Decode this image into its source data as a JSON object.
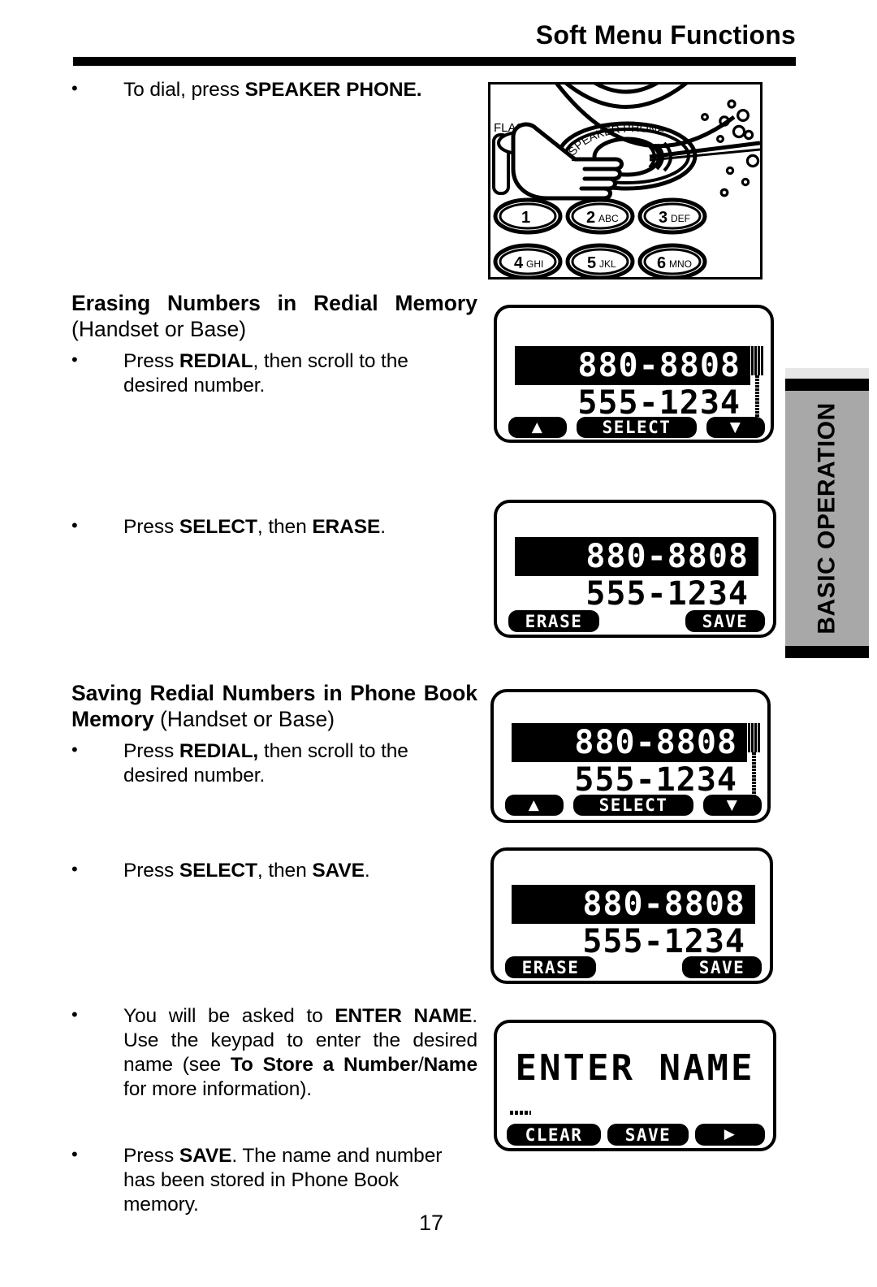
{
  "header": {
    "title": "Soft Menu Functions"
  },
  "side_tab": {
    "label": "BASIC OPERATION",
    "bg_color": "#a8a8a8"
  },
  "page_number": "17",
  "content": {
    "bullet_dial": {
      "text_before": "To dial, press ",
      "bold": "SPEAKER PHONE."
    },
    "section_erasing": {
      "title_line1": "Erasing Numbers in Redial Memory",
      "title_line2": "(Handset or Base)",
      "bullet_1": {
        "before": "Press ",
        "bold": "REDIAL",
        "after": ", then scroll to the desired number."
      },
      "bullet_2": {
        "before": "Press ",
        "bold1": "SELECT",
        "mid": ", then ",
        "bold2": "ERASE",
        "after": "."
      }
    },
    "section_saving": {
      "title_line1": "Saving Redial Numbers in Phone Book",
      "title_line2_bold": "Memory",
      "title_line2_reg": " (Handset or Base)",
      "bullet_1": {
        "before": "Press ",
        "bold": "REDIAL,",
        "after": " then scroll to the desired number."
      },
      "bullet_2": {
        "before": "Press ",
        "bold1": "SELECT",
        "mid": ", then ",
        "bold2": "SAVE",
        "after": "."
      },
      "bullet_3": {
        "p1": "You will be asked to ",
        "b1": "ENTER NAME",
        "p2": ". Use the keypad to enter the desired name (see ",
        "b2": "To Store a Number",
        "p3": "/",
        "b3": "Name",
        "p4": " for more information)."
      },
      "bullet_4": {
        "before": "Press ",
        "bold": "SAVE",
        "after": ". The name and number has been stored in Phone Book memory."
      }
    }
  },
  "illustration": {
    "name": "keypad-speakerphone-press",
    "flash_label": "FLASH",
    "speaker_label": "SPEAKER PHONE",
    "keys": [
      {
        "digit": "1",
        "letters": ""
      },
      {
        "digit": "2",
        "letters": "ABC"
      },
      {
        "digit": "3",
        "letters": "DEF"
      },
      {
        "digit": "4",
        "letters": "GHI"
      },
      {
        "digit": "5",
        "letters": "JKL"
      },
      {
        "digit": "6",
        "letters": "MNO"
      }
    ]
  },
  "lcd_screens": [
    {
      "id": "lcd-redial-select-1",
      "line_highlight": "880-8808",
      "line_normal": "555-1234",
      "scroll_indicator": true,
      "softkeys": [
        {
          "name": "scroll-up",
          "label": "",
          "icon": "up-arrow-icon"
        },
        {
          "name": "select",
          "label": "SELECT",
          "icon": ""
        },
        {
          "name": "scroll-down",
          "label": "",
          "icon": "down-arrow-icon"
        }
      ]
    },
    {
      "id": "lcd-erase-save-1",
      "line_highlight": "880-8808",
      "line_normal": "555-1234",
      "scroll_indicator": false,
      "softkeys": [
        {
          "name": "erase",
          "label": "ERASE",
          "icon": ""
        },
        {
          "name": "save",
          "label": "SAVE",
          "icon": ""
        }
      ]
    },
    {
      "id": "lcd-redial-select-2",
      "line_highlight": "880-8808",
      "line_normal": "555-1234",
      "scroll_indicator": true,
      "softkeys": [
        {
          "name": "scroll-up",
          "label": "",
          "icon": "up-arrow-icon"
        },
        {
          "name": "select",
          "label": "SELECT",
          "icon": ""
        },
        {
          "name": "scroll-down",
          "label": "",
          "icon": "down-arrow-icon"
        }
      ]
    },
    {
      "id": "lcd-erase-save-2",
      "line_highlight": "880-8808",
      "line_normal": "555-1234",
      "scroll_indicator": false,
      "softkeys": [
        {
          "name": "erase",
          "label": "ERASE",
          "icon": ""
        },
        {
          "name": "save",
          "label": "SAVE",
          "icon": ""
        }
      ]
    },
    {
      "id": "lcd-enter-name",
      "line_main": "ENTER NAME",
      "cursor": true,
      "softkeys": [
        {
          "name": "clear",
          "label": "CLEAR",
          "icon": ""
        },
        {
          "name": "save",
          "label": "SAVE",
          "icon": ""
        },
        {
          "name": "next-char",
          "label": "",
          "icon": "right-arrow-icon"
        }
      ]
    }
  ]
}
